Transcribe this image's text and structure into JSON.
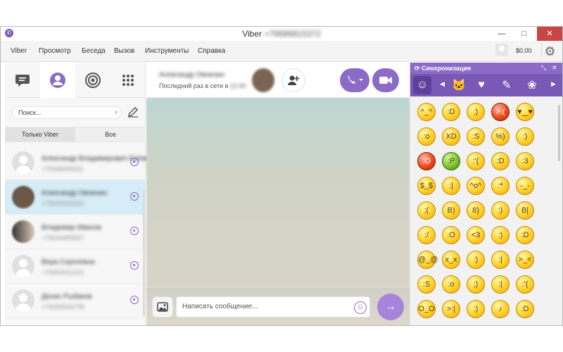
{
  "window": {
    "title_app": "Viber",
    "title_number": "+79686815372",
    "btn_minimize": "—",
    "btn_maximize": "□",
    "btn_close": "✕"
  },
  "menu": {
    "items": [
      "Viber",
      "Просмотр",
      "Беседа",
      "Вызов",
      "Инструменты",
      "Справка"
    ],
    "credit": "$0.00"
  },
  "sidebar": {
    "search_placeholder": "Поиск...",
    "filter_viber": "Только Viber",
    "filter_all": "Все",
    "contacts": [
      {
        "name": "Александр Владимирович Ерёмин",
        "sub": "+79165004411"
      },
      {
        "name": "Александр Овчинин",
        "sub": "+79160033322"
      },
      {
        "name": "Владимир Иванов",
        "sub": "+79104455667"
      },
      {
        "name": "Вера Сергеевна",
        "sub": "+79250011223"
      },
      {
        "name": "Денис Рыбаков",
        "sub": "+79265544778"
      }
    ]
  },
  "chat": {
    "contact_name": "Александр Овчинин",
    "status_prefix": "Последний раз в сети в",
    "status_time": "12:40",
    "input_placeholder": "Написать сообщение..."
  },
  "stickers": {
    "title": "Синхронизация",
    "rows": [
      [
        "^_^",
        ":D",
        ";)",
        ">:(",
        "♥‿♥"
      ],
      [
        ":o",
        "XD",
        ":S",
        "%)",
        ":)"
      ],
      [
        ":O",
        ":P",
        ":'(",
        ":D",
        ":3"
      ],
      [
        "$_$",
        ":|",
        "^o^",
        ":*",
        "-_-"
      ],
      [
        ";(",
        "B)",
        "8)",
        ":)",
        "B|"
      ],
      [
        ":/",
        ":O",
        "<3",
        ":)",
        ":D"
      ],
      [
        "@_@",
        "x_x",
        ":)",
        ":|",
        ">_<"
      ],
      [
        ":S",
        ":o",
        ";)",
        ":|",
        ":'("
      ],
      [
        "O_O",
        ">:|",
        ":)",
        "♪",
        ":D"
      ]
    ]
  },
  "colors": {
    "accent": "#8b6bc7",
    "accent_dark": "#7a58b6",
    "selected_row": "#d6ecf6"
  }
}
